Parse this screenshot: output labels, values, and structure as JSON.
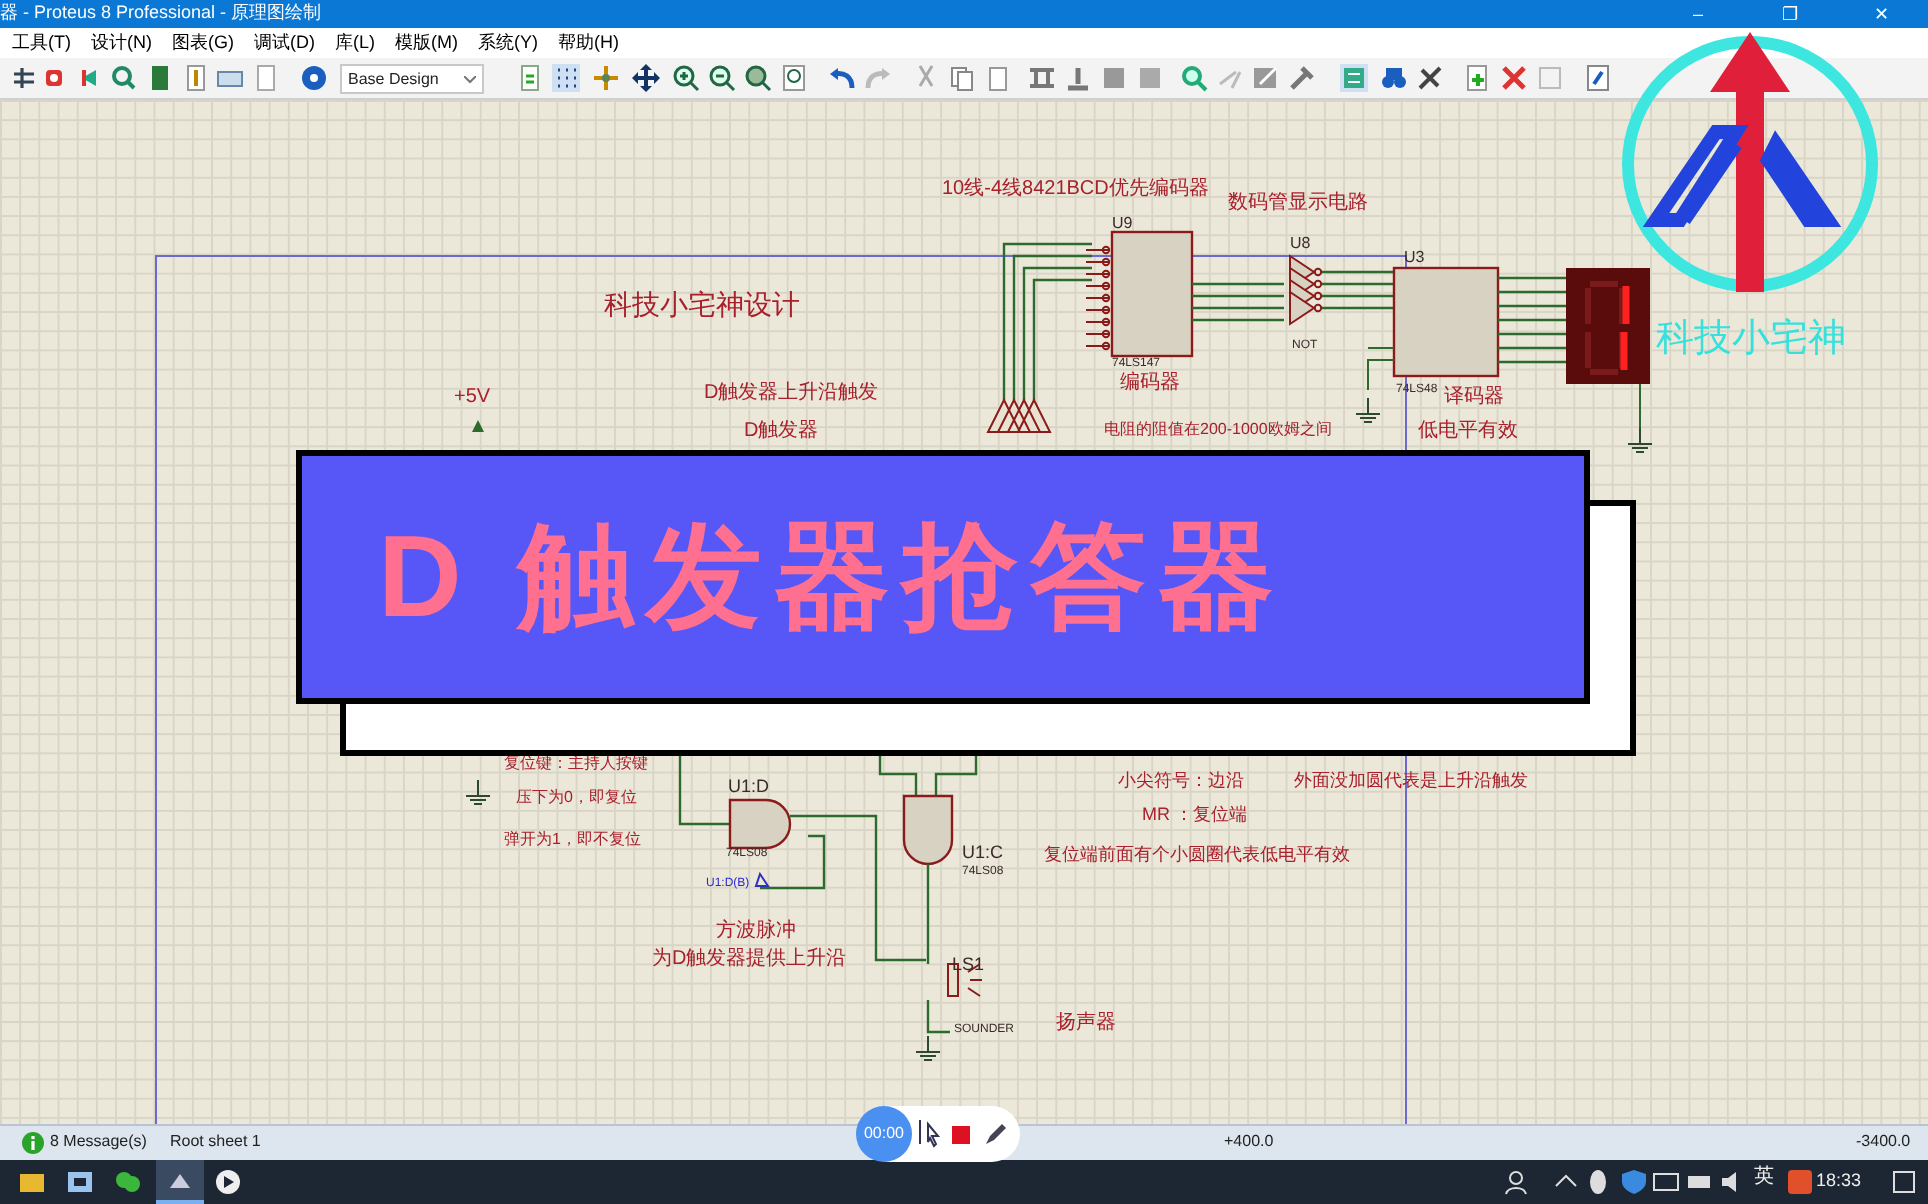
{
  "window": {
    "title": "器 - Proteus 8 Professional - 原理图绘制",
    "controls": [
      "–",
      "❐",
      "✕"
    ]
  },
  "menu": [
    "工具(T)",
    "设计(N)",
    "图表(G)",
    "调试(D)",
    "库(L)",
    "模版(M)",
    "系统(Y)",
    "帮助(H)"
  ],
  "toolbar": {
    "design_dropdown": "Base Design"
  },
  "schematic": {
    "labels": [
      "10线-4线8421BCD优先编码器",
      "数码管显示电路",
      "U9",
      "U8",
      "U3",
      "科技小宅神设计",
      "74LS147",
      "NOT",
      "+5V",
      "D触发器上升沿触发",
      "编码器",
      "74LS48",
      "译码器",
      "D触发器",
      "电阻的阻值在200-1000欧姆之间",
      "低电平有效",
      "复位键：主持人按键",
      "压下为0，即复位",
      "弹开为1，即不复位",
      "U1:D",
      "74LS08",
      "U1:C",
      "74LS08",
      "U1:D(B)",
      "方波脉冲",
      "为D触发器提供上升沿",
      "LS1",
      "SOUNDER",
      "扬声器",
      "小尖符号：边沿",
      "外面没加圆代表是上升沿触发",
      "MR ：复位端",
      "复位端前面有个小圆圈代表低电平有效"
    ]
  },
  "banner": {
    "title": "D 触发器抢答器"
  },
  "logo": {
    "text": "科技小宅神"
  },
  "status_bar": {
    "messages": "8 Message(s)",
    "sheet": "Root sheet 1",
    "x_coord": "+400.0",
    "y_coord": "-3400.0"
  },
  "recorder": {
    "time": "00:00"
  },
  "taskbar": {
    "ime": "英",
    "clock": "18:33"
  }
}
